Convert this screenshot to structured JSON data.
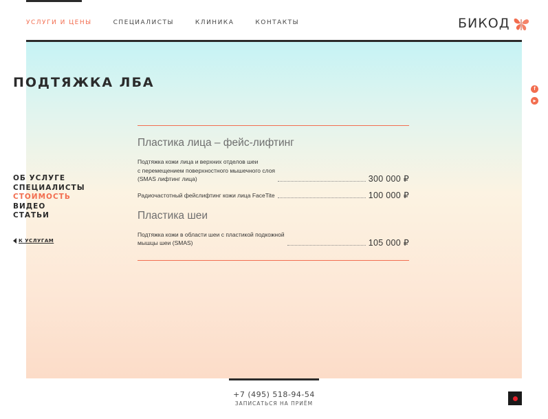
{
  "nav": {
    "items": [
      {
        "label": "УСЛУГИ И ЦЕНЫ",
        "active": true
      },
      {
        "label": "СПЕЦИАЛИСТЫ",
        "active": false
      },
      {
        "label": "КЛИНИКА",
        "active": false
      },
      {
        "label": "КОНТАКТЫ",
        "active": false
      }
    ]
  },
  "logo": {
    "text": "БИКОД",
    "icon": "butterfly-icon"
  },
  "page": {
    "title": "ПОДТЯЖКА ЛБА"
  },
  "social": [
    {
      "icon": "facebook-icon",
      "glyph": "f"
    },
    {
      "icon": "youtube-icon",
      "glyph": "▶"
    }
  ],
  "sidenav": {
    "items": [
      {
        "label": "ОБ УСЛУГЕ",
        "active": false
      },
      {
        "label": "СПЕЦИАЛИСТЫ",
        "active": false
      },
      {
        "label": "СТОИМОСТЬ",
        "active": true
      },
      {
        "label": "ВИДЕО",
        "active": false
      },
      {
        "label": "СТАТЬИ",
        "active": false
      }
    ],
    "back_label": "К УСЛУГАМ"
  },
  "prices": {
    "sections": [
      {
        "title": "Пластика лица – фейс-лифтинг",
        "rows": [
          {
            "name_lines": [
              "Подтяжка кожи лица и верхних отделов шеи",
              "с перемещением поверхностного мышечного слоя",
              "(SMAS лифтинг лица)"
            ],
            "price": "300 000 ₽"
          },
          {
            "name_lines": [
              "Радиочастотный фейслифтинг кожи лица FaceTite"
            ],
            "price": "100 000 ₽"
          }
        ]
      },
      {
        "title": "Пластика шеи",
        "rows": [
          {
            "name_lines": [
              "Подтяжка кожи в области шеи с пластикой подкожной",
              "мышцы шеи (SMAS)"
            ],
            "price": "105 000 ₽"
          }
        ]
      }
    ]
  },
  "footer": {
    "phone": "+7 (495) 518-94-54",
    "cta": "ЗАПИСАТЬСЯ НА ПРИЁМ"
  },
  "colors": {
    "accent": "#f26d4f",
    "dark": "#2b2b2b"
  }
}
